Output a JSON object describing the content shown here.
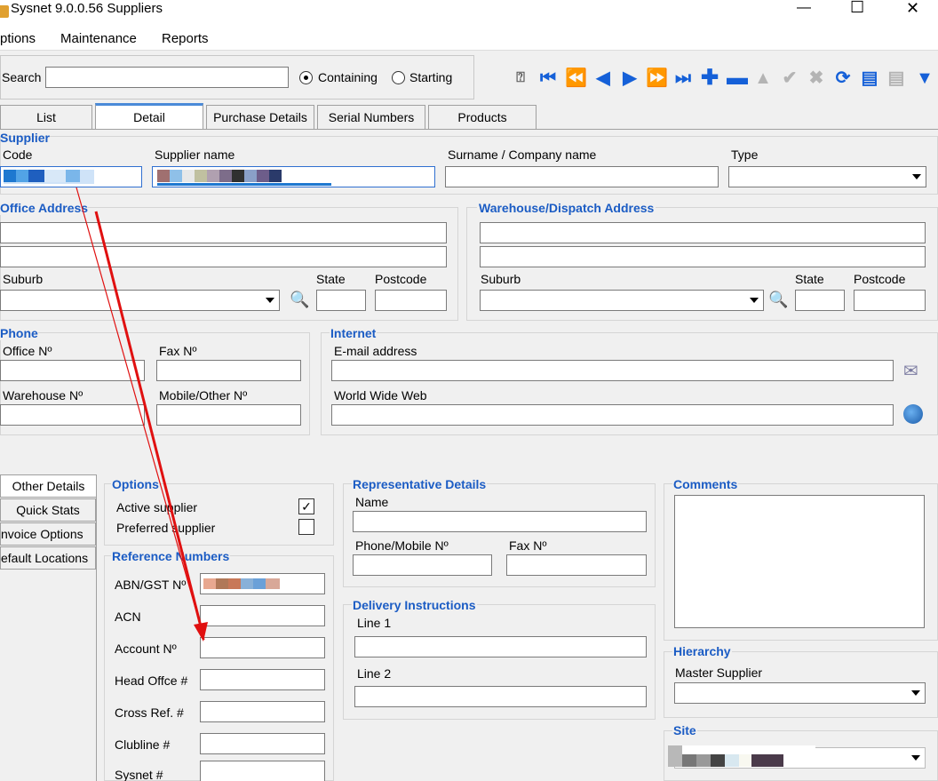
{
  "window": {
    "title": "Sysnet 9.0.0.56 Suppliers",
    "minimize": "—",
    "maximize": "☐",
    "close": "✕"
  },
  "menu": {
    "options": "ptions",
    "maintenance": "Maintenance",
    "reports": "Reports"
  },
  "search": {
    "label": "Search",
    "value": "",
    "opt_containing": "Containing",
    "opt_starting": "Starting"
  },
  "toolbar": {
    "colors": {
      "active": "#1560d8",
      "disabled": "#b4b4b4"
    }
  },
  "tabs": [
    "List",
    "Detail",
    "Purchase Details",
    "Serial Numbers",
    "Products"
  ],
  "supplier": {
    "section": "Supplier",
    "code_label": "Code",
    "name_label": "Supplier name",
    "surname_label": "Surname / Company name",
    "type_label": "Type"
  },
  "office": {
    "section": "Office Address",
    "suburb": "Suburb",
    "state": "State",
    "postcode": "Postcode"
  },
  "warehouse": {
    "section": "Warehouse/Dispatch Address",
    "suburb": "Suburb",
    "state": "State",
    "postcode": "Postcode"
  },
  "phone": {
    "section": "Phone",
    "office": "Office Nº",
    "fax": "Fax Nº",
    "warehouse": "Warehouse Nº",
    "mobile": "Mobile/Other Nº"
  },
  "internet": {
    "section": "Internet",
    "email": "E-mail address",
    "www": "World Wide Web"
  },
  "side_tabs": [
    "Other Details",
    "Quick Stats",
    "nvoice Options",
    "efault Locations"
  ],
  "options": {
    "section": "Options",
    "active": "Active supplier",
    "active_checked": "✓",
    "preferred": "Preferred supplier"
  },
  "reference": {
    "section": "Reference Numbers",
    "abn": "ABN/GST Nº",
    "acn": "ACN",
    "account": "Account Nº",
    "head": "Head Offce #",
    "cross": "Cross Ref. #",
    "clubline": "Clubline #",
    "sysnet": "Sysnet #"
  },
  "rep": {
    "section": "Representative Details",
    "name": "Name",
    "phone": "Phone/Mobile Nº",
    "fax": "Fax Nº"
  },
  "delivery": {
    "section": "Delivery Instructions",
    "line1": "Line 1",
    "line2": "Line 2"
  },
  "comments": {
    "section": "Comments"
  },
  "hierarchy": {
    "section": "Hierarchy",
    "master": "Master Supplier"
  },
  "site": {
    "section": "Site"
  },
  "annotation": {
    "color": "#e01010"
  }
}
